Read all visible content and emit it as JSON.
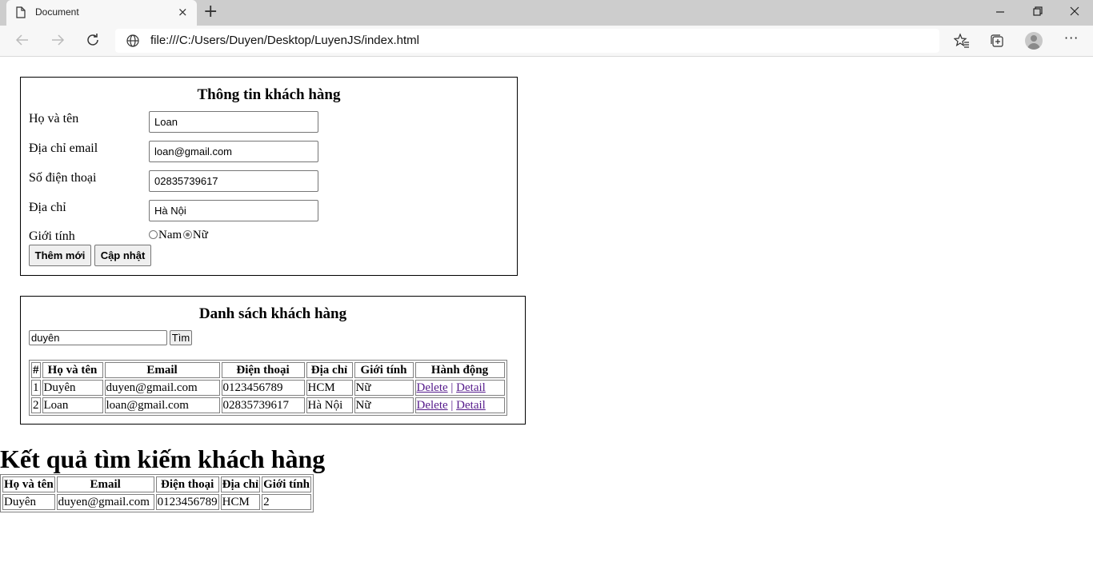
{
  "browser": {
    "tab_title": "Document",
    "tab_close": "×",
    "new_tab": "+",
    "url": "file:///C:/Users/Duyen/Desktop/LuyenJS/index.html",
    "icons": [
      "page-icon",
      "back-icon",
      "forward-icon",
      "refresh-icon",
      "globe-icon",
      "favorites-icon",
      "collections-icon",
      "profile-icon",
      "more-icon",
      "minimize-icon",
      "restore-icon",
      "close-icon"
    ]
  },
  "form": {
    "title": "Thông tin khách hàng",
    "name_label": "Họ và tên",
    "name_value": "Loan",
    "email_label": "Địa chỉ email",
    "email_value": "loan@gmail.com",
    "phone_label": "Số điện thoại",
    "phone_value": "02835739617",
    "address_label": "Địa chỉ",
    "address_value": "Hà Nội",
    "gender_label": "Giới tính",
    "gender_male": "Nam",
    "gender_female": "Nữ",
    "gender_selected": "Nữ",
    "add_button": "Thêm mới",
    "update_button": "Cập nhật"
  },
  "list": {
    "title": "Danh sách khách hàng",
    "search_value": "duyên",
    "search_button": "Tìm",
    "headers": [
      "#",
      "Họ và tên",
      "Email",
      "Điện thoại",
      "Địa chỉ",
      "Giới tính",
      "Hành động"
    ],
    "rows": [
      {
        "index": "1",
        "name": "Duyên",
        "email": "duyen@gmail.com",
        "phone": "0123456789",
        "address": "HCM",
        "gender": "Nữ",
        "delete": "Delete",
        "sep": "|",
        "detail": "Detail"
      },
      {
        "index": "2",
        "name": "Loan",
        "email": "loan@gmail.com",
        "phone": "02835739617",
        "address": "Hà Nội",
        "gender": "Nữ",
        "delete": "Delete",
        "sep": "|",
        "detail": "Detail"
      }
    ]
  },
  "results": {
    "title": "Kết quả tìm kiếm khách hàng",
    "headers": [
      "Họ và tên",
      "Email",
      "Điện thoại",
      "Địa chỉ",
      "Giới tính"
    ],
    "rows": [
      {
        "name": "Duyên",
        "email": "duyen@gmail.com",
        "phone": "0123456789",
        "address": "HCM",
        "gender": "2"
      }
    ]
  }
}
